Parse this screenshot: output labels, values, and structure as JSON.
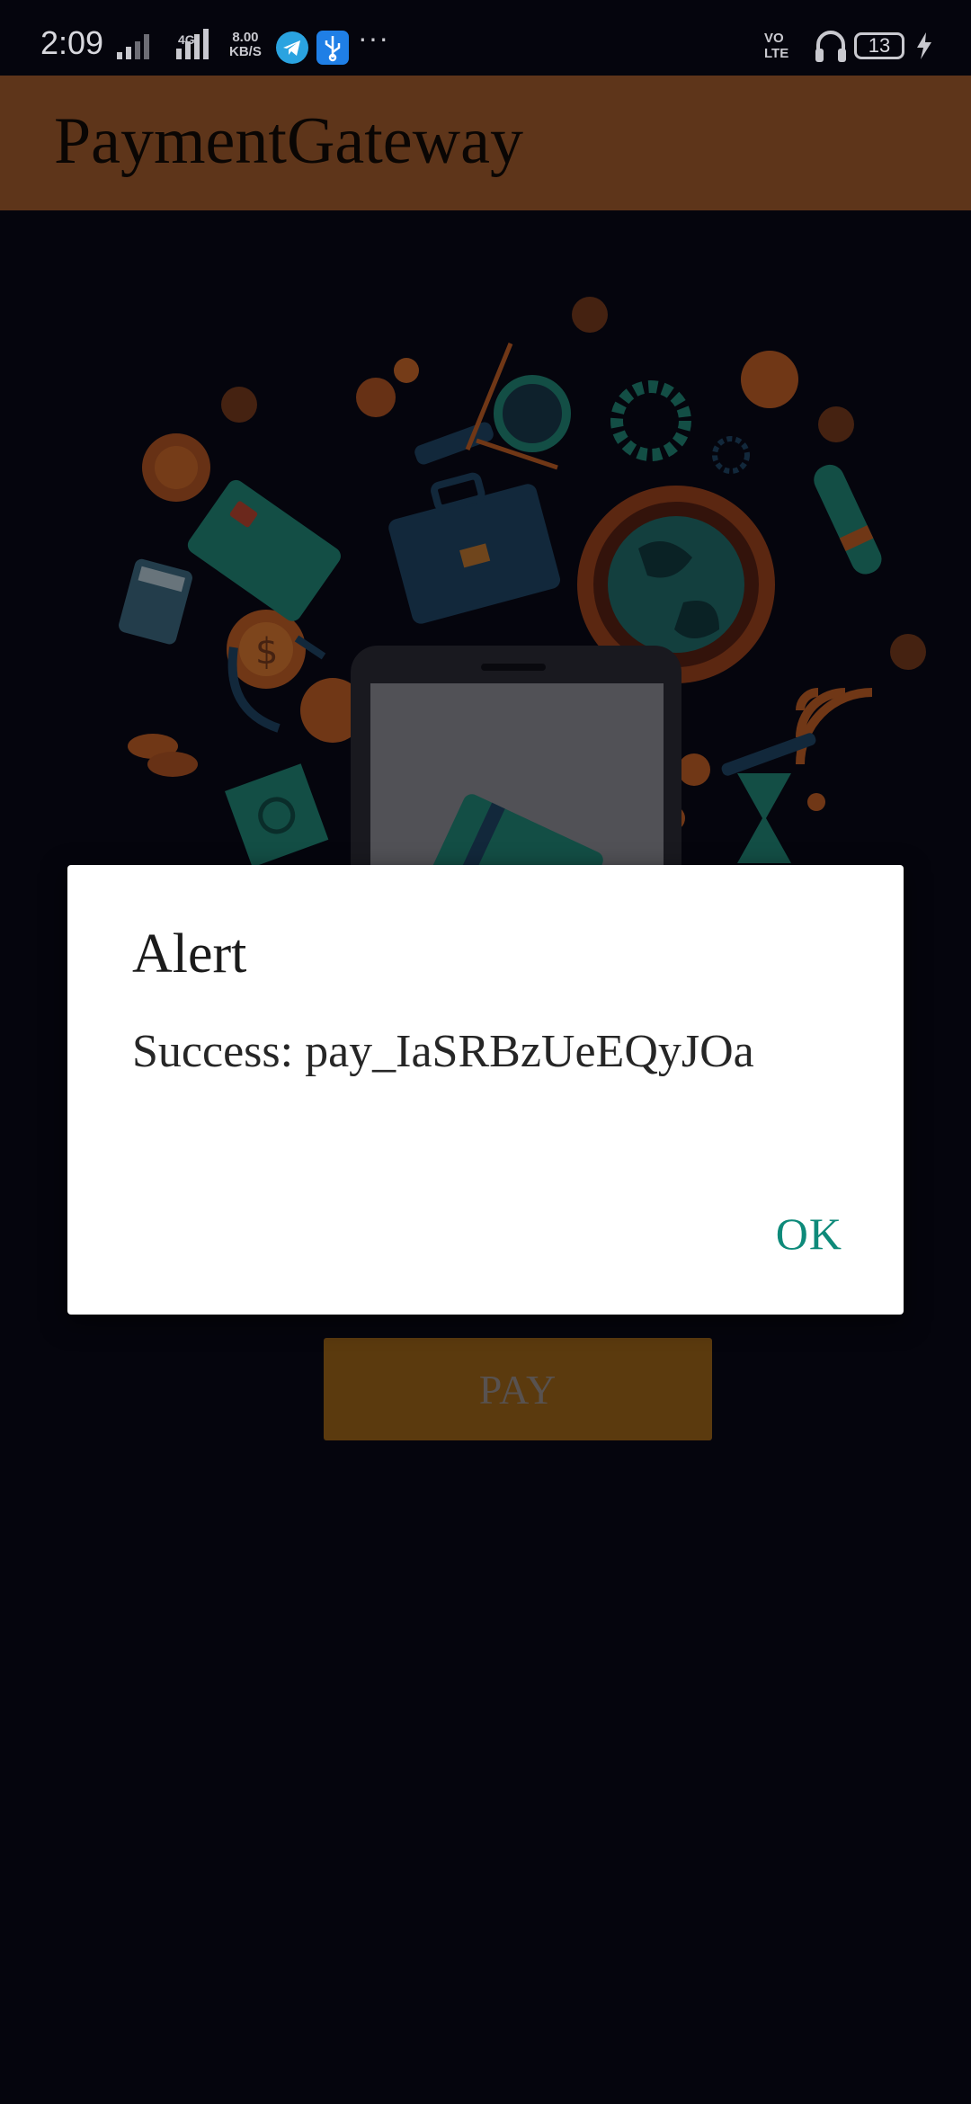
{
  "status_bar": {
    "time": "2:09",
    "network_type": "4G",
    "speed_value": "8.00",
    "speed_unit": "KB/S",
    "more": "···",
    "volte_line1": "VO",
    "volte_line2": "LTE",
    "battery": "13"
  },
  "app_bar": {
    "title": "PaymentGateway"
  },
  "main": {
    "pay_label": "PAY"
  },
  "dialog": {
    "title": "Alert",
    "message": "Success: pay_IaSRBzUeEQyJOa",
    "ok_label": "OK"
  },
  "colors": {
    "app_bar": "#5e351a",
    "pay_button": "#5b3a0e",
    "accent_ok": "#0e8a7a",
    "background": "#05050d"
  }
}
